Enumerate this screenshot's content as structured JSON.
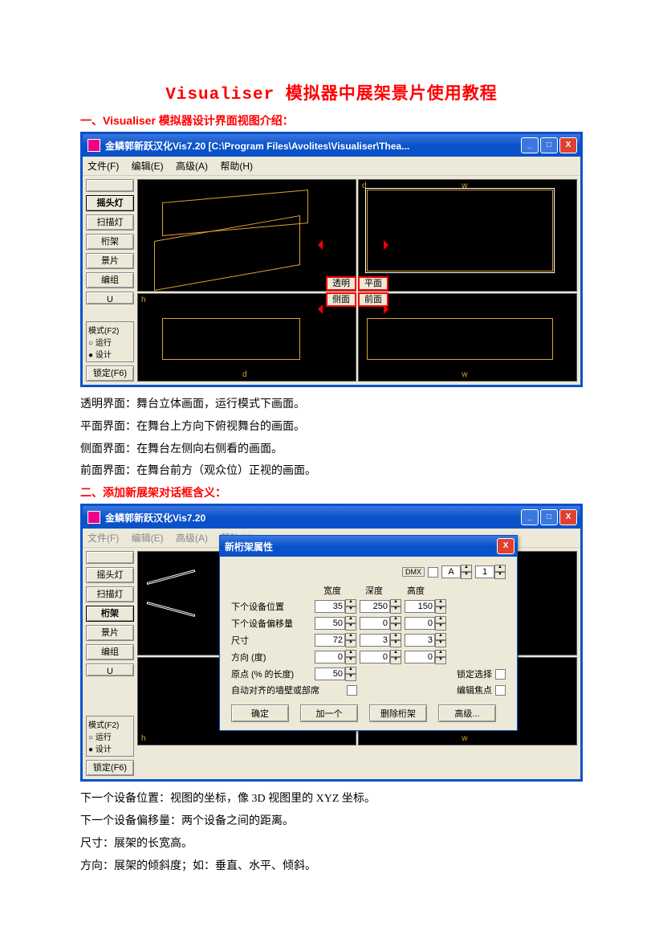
{
  "title": "Visualiser 模拟器中展架景片使用教程",
  "section1_heading": "一、Visualiser 模拟器设计界面视图介绍：",
  "win1": {
    "title": "金鳞郭新跃汉化Vis7.20 [C:\\Program Files\\Avolites\\Visualiser\\Thea...",
    "menu": {
      "file": "文件(F)",
      "edit": "编辑(E)",
      "adv": "高级(A)",
      "help": "帮助(H)"
    },
    "tools": {
      "b1": "摇头灯",
      "b2": "扫描灯",
      "b3": "桁架",
      "b4": "景片",
      "b5": "编组",
      "b6": "U"
    },
    "mode": {
      "hdr": "模式(F2)",
      "run": "运行",
      "design": "设计"
    },
    "lock": "锁定(F6)",
    "center": {
      "tl": "透明",
      "tr": "平面",
      "bl": "侧面",
      "br": "前面"
    },
    "axis": {
      "h": "h",
      "d": "d",
      "w": "w"
    }
  },
  "desc1": {
    "l1": "透明界面：舞台立体画面，运行模式下画面。",
    "l2": "平面界面：在舞台上方向下俯视舞台的画面。",
    "l3": "侧面界面：在舞台左侧向右侧看的画面。",
    "l4": "前面界面：在舞台前方（观众位）正视的画面。"
  },
  "section2_heading": "二、添加新展架对话框含义：",
  "win2": {
    "title": "金鳞郭新跃汉化Vis7.20",
    "dialog_title": "新桁架属性",
    "dmx": "DMX",
    "selA": "A",
    "sel1": "1",
    "cols": {
      "w": "宽度",
      "d": "深度",
      "h": "高度"
    },
    "rows": {
      "r1_lbl": "下个设备位置",
      "r1": {
        "a": "35",
        "b": "250",
        "c": "150"
      },
      "r2_lbl": "下个设备偏移量",
      "r2": {
        "a": "50",
        "b": "0",
        "c": "0"
      },
      "r3_lbl": "尺寸",
      "r3": {
        "a": "72",
        "b": "3",
        "c": "3"
      },
      "r4_lbl": "方向 (度)",
      "r4": {
        "a": "0",
        "b": "0",
        "c": "0"
      },
      "r5_lbl": "原点 (% 的长度)",
      "r5": {
        "a": "50"
      },
      "lock_sel": "锁定选择",
      "auto_align": "自动对齐的墙壁或部席",
      "edit_focus": "编辑焦点"
    },
    "btns": {
      "ok": "确定",
      "add": "加一个",
      "del": "删除桁架",
      "adv": "高级..."
    }
  },
  "desc2": {
    "l1": "下一个设备位置：视图的坐标，像 3D 视图里的 XYZ 坐标。",
    "l2": "下一个设备偏移量：两个设备之间的距离。",
    "l3": "尺寸：展架的长宽高。",
    "l4": "方向：展架的倾斜度；如：垂直、水平、倾斜。"
  }
}
